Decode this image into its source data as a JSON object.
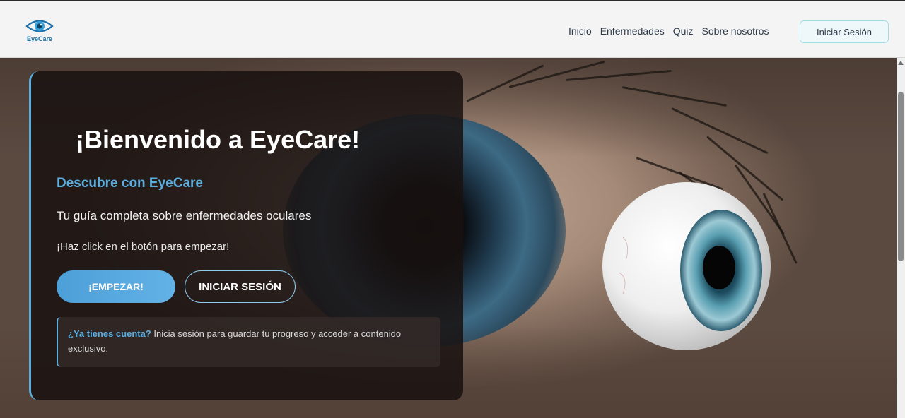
{
  "brand": {
    "name": "EyeCare",
    "accent": "#5aaee0",
    "logo_color": "#1b6fa8"
  },
  "nav": {
    "links": [
      "Inicio",
      "Enfermedades",
      "Quiz",
      "Sobre nosotros"
    ],
    "login_label": "Iniciar Sesión"
  },
  "hero": {
    "title": "¡Bienvenido a EyeCare!",
    "subtitle": "Descubre con EyeCare",
    "description": "Tu guía completa sobre enfermedades oculares",
    "cta_text": "¡Haz click en el botón para empezar!",
    "start_button": "¡EMPEZAR!",
    "login_button": "INICIAR SESIÓN",
    "info": {
      "strong": "¿Ya tienes cuenta?",
      "text": " Inicia sesión para guardar tu progreso y acceder a contenido exclusivo."
    }
  }
}
